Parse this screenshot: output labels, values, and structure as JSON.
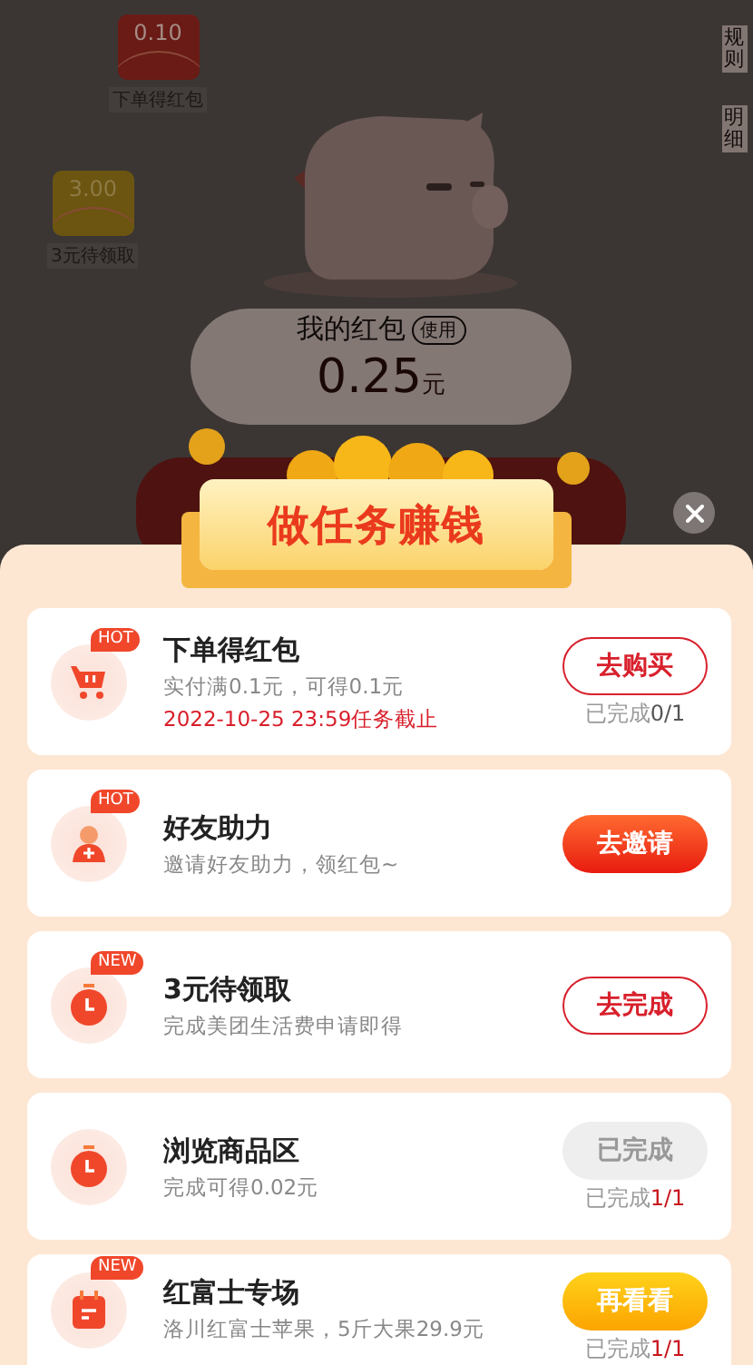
{
  "background": {
    "packets": [
      {
        "kind": "red",
        "amount": "0.10",
        "label": "下单得红包"
      },
      {
        "kind": "gold",
        "amount": "3.00",
        "label": "3元待领取"
      }
    ],
    "side_links": [
      "规则",
      "明细"
    ],
    "wallet": {
      "title": "我的红包",
      "use_badge": "使用",
      "amount": "0.25",
      "unit": "元"
    }
  },
  "task_panel": {
    "title": "做任务赚钱",
    "tasks": [
      {
        "badge": "HOT",
        "title": "下单得红包",
        "lines": [
          {
            "text": "实付满0.1元，可得0.1元",
            "kind": "muted"
          },
          {
            "text": "2022-10-25 23:59任务截止",
            "kind": "deadline"
          }
        ],
        "button": {
          "label": "去购买",
          "kind": "outline"
        },
        "progress": {
          "label": "已完成",
          "count": "0/1",
          "complete": false
        }
      },
      {
        "badge": "HOT",
        "title": "好友助力",
        "lines": [
          {
            "text": "邀请好友助力，领红包~",
            "kind": "muted"
          }
        ],
        "button": {
          "label": "去邀请",
          "kind": "filled"
        }
      },
      {
        "badge": "NEW",
        "title": "3元待领取",
        "lines": [
          {
            "text": "完成美团生活费申请即得",
            "kind": "muted"
          }
        ],
        "button": {
          "label": "去完成",
          "kind": "outline"
        }
      },
      {
        "title": "浏览商品区",
        "lines": [
          {
            "text": "完成可得0.02元",
            "kind": "muted"
          }
        ],
        "button": {
          "label": "已完成",
          "kind": "done"
        },
        "progress": {
          "label": "已完成",
          "count": "1/1",
          "complete": true
        }
      },
      {
        "badge": "NEW",
        "title": "红富士专场",
        "lines": [
          {
            "text": "洛川红富士苹果，5斤大果29.9元",
            "kind": "muted"
          }
        ],
        "button": {
          "label": "再看看",
          "kind": "gold"
        },
        "progress": {
          "label": "已完成",
          "count": "1/1",
          "complete": true
        }
      }
    ]
  }
}
